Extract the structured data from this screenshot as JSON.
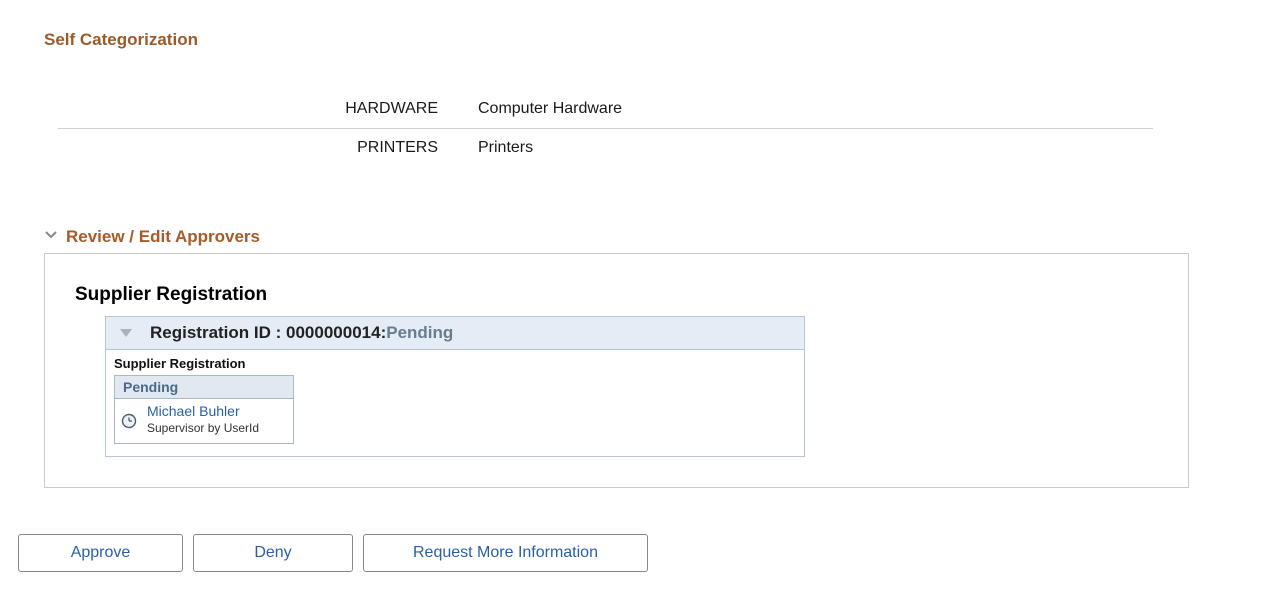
{
  "self_cat": {
    "title": "Self Categorization",
    "rows": [
      {
        "code": "HARDWARE",
        "desc": "Computer Hardware"
      },
      {
        "code": "PRINTERS",
        "desc": "Printers"
      }
    ]
  },
  "approvers": {
    "header": "Review / Edit Approvers",
    "panel_title": "Supplier Registration",
    "registration": {
      "label_prefix": "Registration ID : ",
      "id": "0000000014",
      "colon": ":",
      "status": "Pending",
      "sub_label": "Supplier Registration"
    },
    "card": {
      "status": "Pending",
      "name": "Michael Buhler",
      "role": "Supervisor by UserId"
    }
  },
  "actions": {
    "approve": "Approve",
    "deny": "Deny",
    "request_more": "Request More Information"
  }
}
